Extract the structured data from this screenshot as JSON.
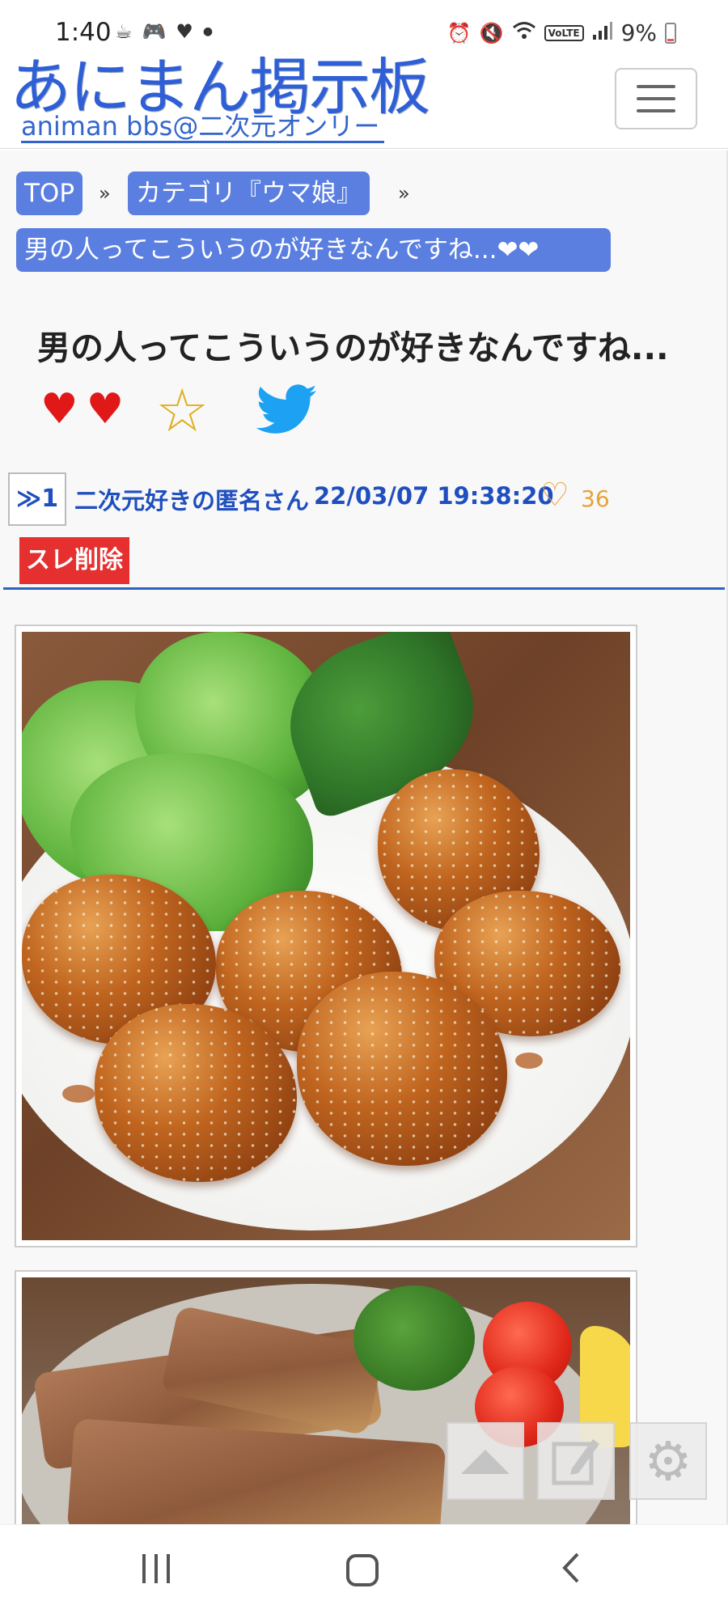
{
  "status_bar": {
    "time": "1:40",
    "left_icons": [
      "cup-icon",
      "gamepad-icon",
      "heart-icon",
      "dot-icon"
    ],
    "right_icons": [
      "alarm-icon",
      "mute-icon",
      "wifi-icon",
      "volte-icon",
      "signal-icon"
    ],
    "volte": "VoLTE",
    "battery": "9%"
  },
  "header": {
    "logo_main": "あにまん掲示板",
    "logo_sub": "animan bbs@二次元オンリー",
    "menu_icon": "hamburger-icon"
  },
  "breadcrumb": {
    "top": "TOP",
    "category": "カテゴリ『ウマ娘』",
    "separator": "»",
    "current": "男の人ってこういうのが好きなんですね...❤❤"
  },
  "thread": {
    "title": "男の人ってこういうのが好きなんですね...",
    "actions": {
      "hearts": [
        "♥",
        "♥"
      ],
      "star": "☆",
      "share": "twitter-icon"
    }
  },
  "post": {
    "number": "≫1",
    "author": "二次元好きの匿名さん",
    "date": "22/03/07 19:38:20",
    "likes": "36",
    "delete_label": "スレ削除"
  },
  "images": [
    {
      "name": "post-image-pork-rolls"
    },
    {
      "name": "post-image-beef"
    }
  ],
  "floating_buttons": [
    {
      "name": "scroll-top-button",
      "icon": "arrow-up-icon"
    },
    {
      "name": "compose-button",
      "icon": "edit-icon"
    },
    {
      "name": "settings-button",
      "icon": "gear-icon"
    }
  ],
  "nav_bar": {
    "recent": "recent-apps-icon",
    "home": "home-icon",
    "back": "back-icon"
  }
}
